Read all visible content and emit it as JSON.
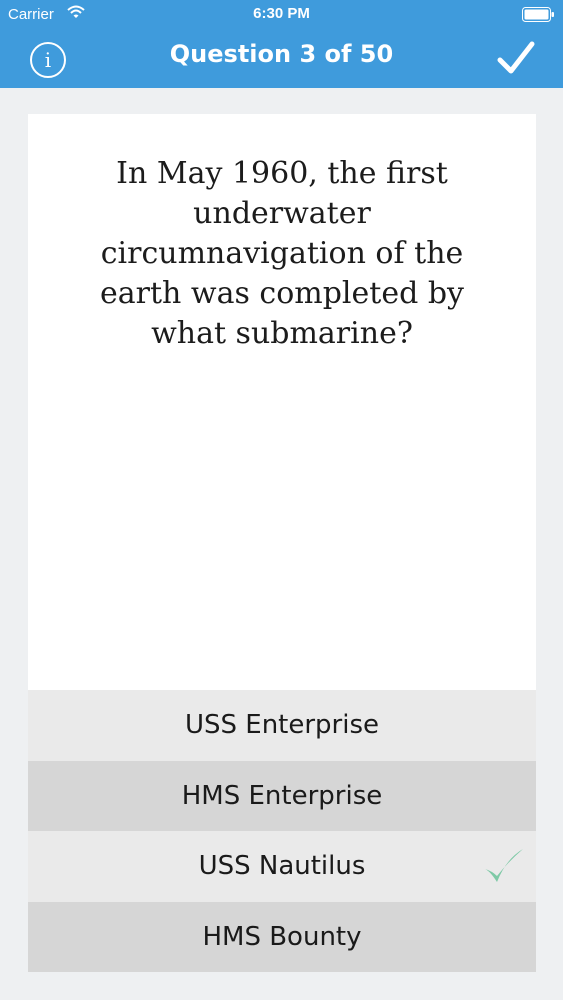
{
  "status_bar": {
    "carrier": "Carrier",
    "time": "6:30 PM"
  },
  "nav": {
    "info_label": "i",
    "title": "Question 3 of 50"
  },
  "question": {
    "text": "In May 1960, the first underwater circumnavigation of the earth was completed by what submarine?"
  },
  "answers": [
    {
      "label": "USS Enterprise",
      "correct": false
    },
    {
      "label": "HMS Enterprise",
      "correct": false
    },
    {
      "label": "USS Nautilus",
      "correct": true
    },
    {
      "label": "HMS Bounty",
      "correct": false
    }
  ],
  "colors": {
    "header": "#3f9bdc",
    "background": "#eef0f2",
    "card": "#ffffff",
    "answer_light": "#eaeaea",
    "answer_dark": "#d6d6d6",
    "correct_check": "#7ec9a6"
  },
  "icons": {
    "wifi": "wifi-icon",
    "battery": "battery-icon",
    "info": "info-icon",
    "done": "checkmark-icon",
    "correct": "check-icon"
  }
}
